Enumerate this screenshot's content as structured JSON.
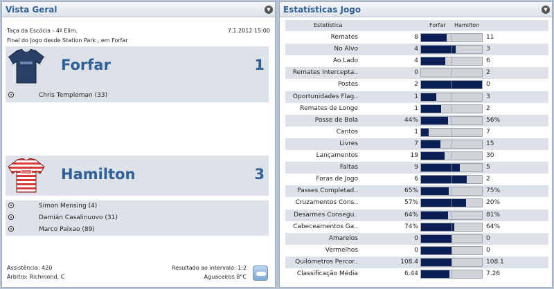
{
  "overview": {
    "title": "Vista Geral",
    "competition": "Taça da Escócia - 4ª Elim.",
    "date": "7.1.2012 15:00",
    "venue_line": "Final do Jogo desde Station Park , em Forfar",
    "home": {
      "name": "Forfar",
      "score": "1",
      "kit_colors": {
        "main": "#2a3f66",
        "sleeve": "#1e2e4f",
        "trim": "#ffffff"
      },
      "scorers": [
        "Chris Templeman (33)"
      ]
    },
    "away": {
      "name": "Hamilton",
      "score": "3",
      "kit_colors": {
        "main": "#ffffff",
        "stripe": "#d83a3a"
      },
      "scorers": [
        "Simon Mensing (4)",
        "Damián Casalinuovo (31)",
        "Marco Paixao (89)"
      ]
    },
    "attendance": "Assistência: 420",
    "referee": "Árbitro: Richmond, C",
    "halftime": "Resultado ao intervalo: 1:2",
    "weather": "Aguaceiros 8°C",
    "weather_icon": "cloud-icon"
  },
  "stats": {
    "title": "Estatísticas Jogo",
    "header": {
      "label": "Estatística",
      "home": "Forfar",
      "away": "Hamilton"
    },
    "accent": "#0c1f55",
    "rows": [
      {
        "label": "Remates",
        "home": "8",
        "away": "11",
        "share": 0.42
      },
      {
        "label": "No Alvo",
        "home": "4",
        "away": "3",
        "share": 0.57
      },
      {
        "label": "Ao Lado",
        "home": "4",
        "away": "6",
        "share": 0.4
      },
      {
        "label": "Remates Intercepta..",
        "home": "0",
        "away": "2",
        "share": 0.0
      },
      {
        "label": "Postes",
        "home": "2",
        "away": "0",
        "share": 1.0
      },
      {
        "label": "Oportunidades Flag..",
        "home": "1",
        "away": "3",
        "share": 0.25
      },
      {
        "label": "Remates de Longe",
        "home": "1",
        "away": "2",
        "share": 0.33
      },
      {
        "label": "Posse de Bola",
        "home": "44%",
        "away": "56%",
        "share": 0.44
      },
      {
        "label": "Cantos",
        "home": "1",
        "away": "7",
        "share": 0.13
      },
      {
        "label": "Livres",
        "home": "7",
        "away": "15",
        "share": 0.32
      },
      {
        "label": "Lançamentos",
        "home": "19",
        "away": "30",
        "share": 0.39
      },
      {
        "label": "Faltas",
        "home": "9",
        "away": "5",
        "share": 0.64
      },
      {
        "label": "Foras de Jogo",
        "home": "6",
        "away": "2",
        "share": 0.75
      },
      {
        "label": "Passes Completad..",
        "home": "65%",
        "away": "75%",
        "share": 0.46
      },
      {
        "label": "Cruzamentos Cons..",
        "home": "57%",
        "away": "20%",
        "share": 0.74
      },
      {
        "label": "Desarmes Consegu..",
        "home": "64%",
        "away": "81%",
        "share": 0.44
      },
      {
        "label": "Cabeceamentos Ga..",
        "home": "74%",
        "away": "64%",
        "share": 0.54
      },
      {
        "label": "Amarelos",
        "home": "0",
        "away": "0",
        "share": 0.5
      },
      {
        "label": "Vermelhos",
        "home": "0",
        "away": "0",
        "share": 0.5
      },
      {
        "label": "Quilómetros Percor..",
        "home": "108.4",
        "away": "108.1",
        "share": 0.5
      },
      {
        "label": "Classificação Média",
        "home": "6.44",
        "away": "7.26",
        "share": 0.47
      }
    ]
  }
}
